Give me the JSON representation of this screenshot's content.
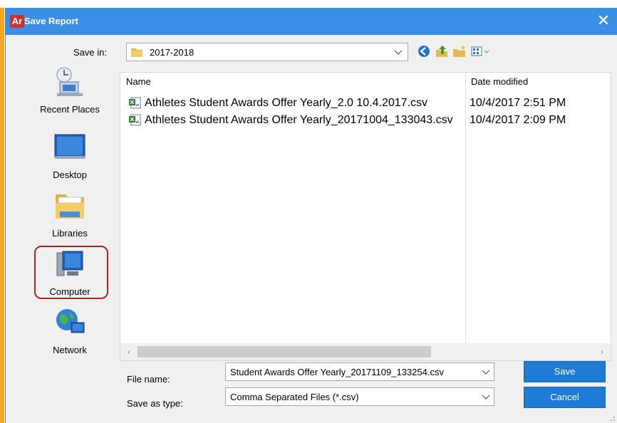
{
  "titlebar": {
    "logo": "Ar",
    "title": "Save Report",
    "close": "✕"
  },
  "save_in": {
    "label": "Save in:",
    "value": "2017-2018"
  },
  "toolbar_icons": [
    "back-icon",
    "up-folder-icon",
    "new-folder-icon",
    "view-menu-icon"
  ],
  "places": [
    {
      "label": "Recent Places",
      "icon": "recent-places-icon"
    },
    {
      "label": "Desktop",
      "icon": "desktop-icon"
    },
    {
      "label": "Libraries",
      "icon": "libraries-icon"
    },
    {
      "label": "Computer",
      "icon": "computer-icon"
    },
    {
      "label": "Network",
      "icon": "network-icon"
    }
  ],
  "file_list": {
    "columns": [
      "Name",
      "Date modified"
    ],
    "rows": [
      {
        "name": "Athletes Student Awards Offer Yearly_2.0 10.4.2017.csv",
        "date": "10/4/2017 2:51 PM"
      },
      {
        "name": "Athletes Student Awards Offer Yearly_20171004_133043.csv",
        "date": "10/4/2017 2:09 PM"
      }
    ]
  },
  "file_name": {
    "label": "File name:",
    "value": "Student Awards Offer Yearly_20171109_133254.csv"
  },
  "save_type": {
    "label": "Save as type:",
    "value": "Comma Separated Files (*.csv)"
  },
  "buttons": {
    "save": "Save",
    "cancel": "Cancel"
  },
  "colors": {
    "titlebar": "#3a8ee6",
    "button": "#1e7bd6",
    "highlight": "#b22222",
    "accent_strip": "#f6a623"
  }
}
